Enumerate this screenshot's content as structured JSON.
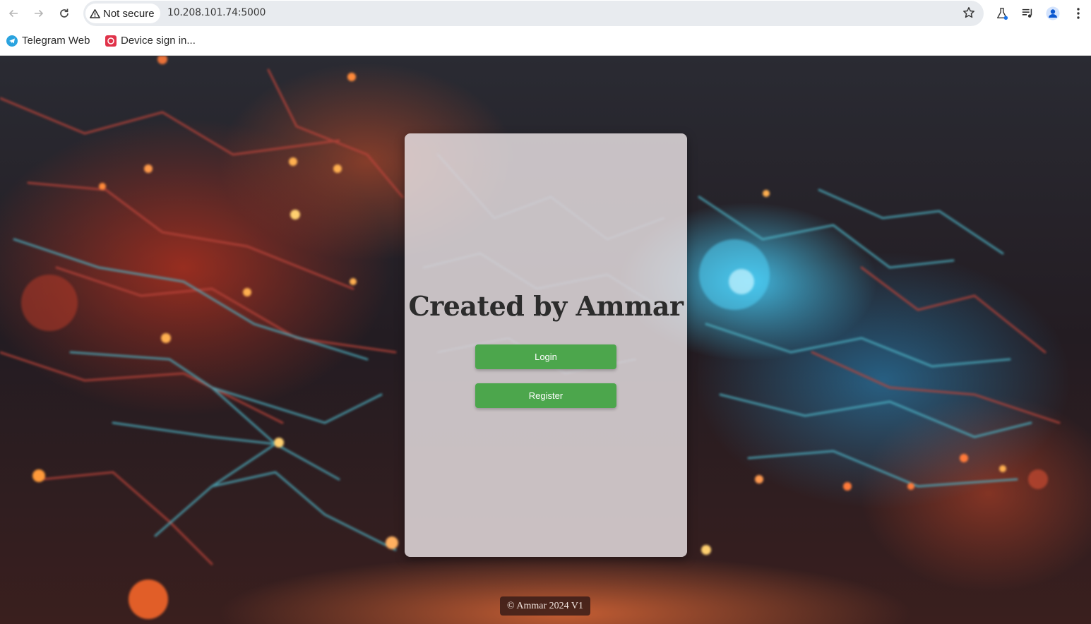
{
  "browser": {
    "nav": {
      "back_icon": "back-arrow-icon",
      "forward_icon": "forward-arrow-icon",
      "reload_icon": "reload-icon"
    },
    "security_label": "Not secure",
    "url": "10.208.101.74:5000",
    "toolbar_icons": [
      "star-icon",
      "labs-flask-icon",
      "media-control-icon",
      "profile-avatar-icon",
      "menu-dots-icon"
    ]
  },
  "bookmarks": [
    {
      "label": "Telegram Web",
      "icon": "telegram-icon",
      "color": "#2aa3df"
    },
    {
      "label": "Device sign in...",
      "icon": "device-signin-icon",
      "color": "#e0334a"
    }
  ],
  "page": {
    "title": "Created by Ammar",
    "login_label": "Login",
    "register_label": "Register",
    "footer": "© Ammar 2024 V1",
    "accent_color": "#4ca64c"
  }
}
